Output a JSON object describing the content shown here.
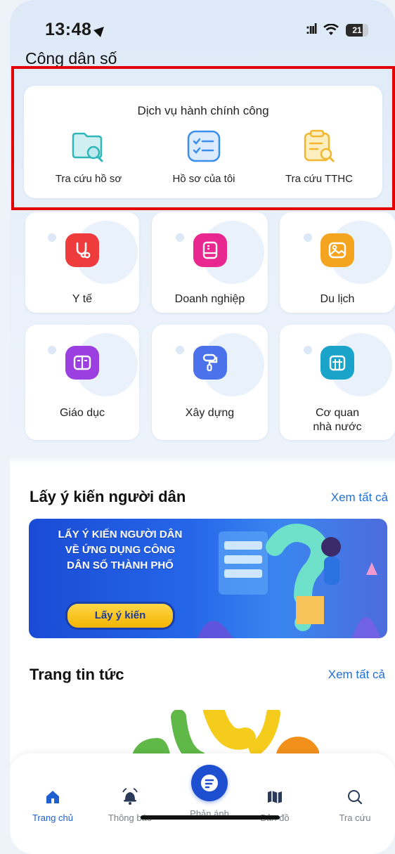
{
  "status_bar": {
    "time": "13:48",
    "battery": "21"
  },
  "header": {
    "title": "Công dân số"
  },
  "public_services": {
    "title": "Dịch vụ hành chính công",
    "items": [
      {
        "label": "Tra cứu hồ sơ",
        "icon": "folder-search-icon"
      },
      {
        "label": "Hồ sơ của tôi",
        "icon": "checklist-icon"
      },
      {
        "label": "Tra cứu TTHC",
        "icon": "clipboard-search-icon"
      }
    ]
  },
  "categories": [
    {
      "label": "Y tế",
      "icon": "stethoscope-icon",
      "color": "#ee3b3b"
    },
    {
      "label": "Doanh nghiệp",
      "icon": "office-icon",
      "color": "#e8278f"
    },
    {
      "label": "Du lịch",
      "icon": "picture-icon",
      "color": "#f4a41f"
    },
    {
      "label": "Giáo dục",
      "icon": "book-icon",
      "color": "#9b3fe0"
    },
    {
      "label": "Xây dựng",
      "icon": "paint-roller-icon",
      "color": "#4b72ea"
    },
    {
      "label": "Cơ quan",
      "label2": "nhà nước",
      "icon": "building-icon",
      "color": "#1aa4c9"
    }
  ],
  "opinion_section": {
    "title": "Lấy ý kiến người dân",
    "see_all": "Xem tất cả",
    "banner": {
      "line1": "LẤY Ý KIẾN NGƯỜI DÂN",
      "line2": "VỀ ỨNG DỤNG CÔNG",
      "line3": "DÂN SỐ THÀNH PHỐ",
      "button": "Lấy ý kiến"
    }
  },
  "news_section": {
    "title": "Trang tin tức",
    "see_all": "Xem tất cả"
  },
  "tabbar": {
    "tabs": [
      {
        "label": "Trang chủ",
        "icon": "home-icon"
      },
      {
        "label": "Thông báo",
        "icon": "bell-icon"
      },
      {
        "label": "Phản ánh",
        "icon": "feedback-icon"
      },
      {
        "label": "Bản đồ",
        "icon": "map-icon"
      },
      {
        "label": "Tra cứu",
        "icon": "search-icon"
      }
    ]
  },
  "colors": {
    "accent": "#1f5fd0",
    "highlight": "#e30000",
    "link": "#1e6fd9"
  }
}
